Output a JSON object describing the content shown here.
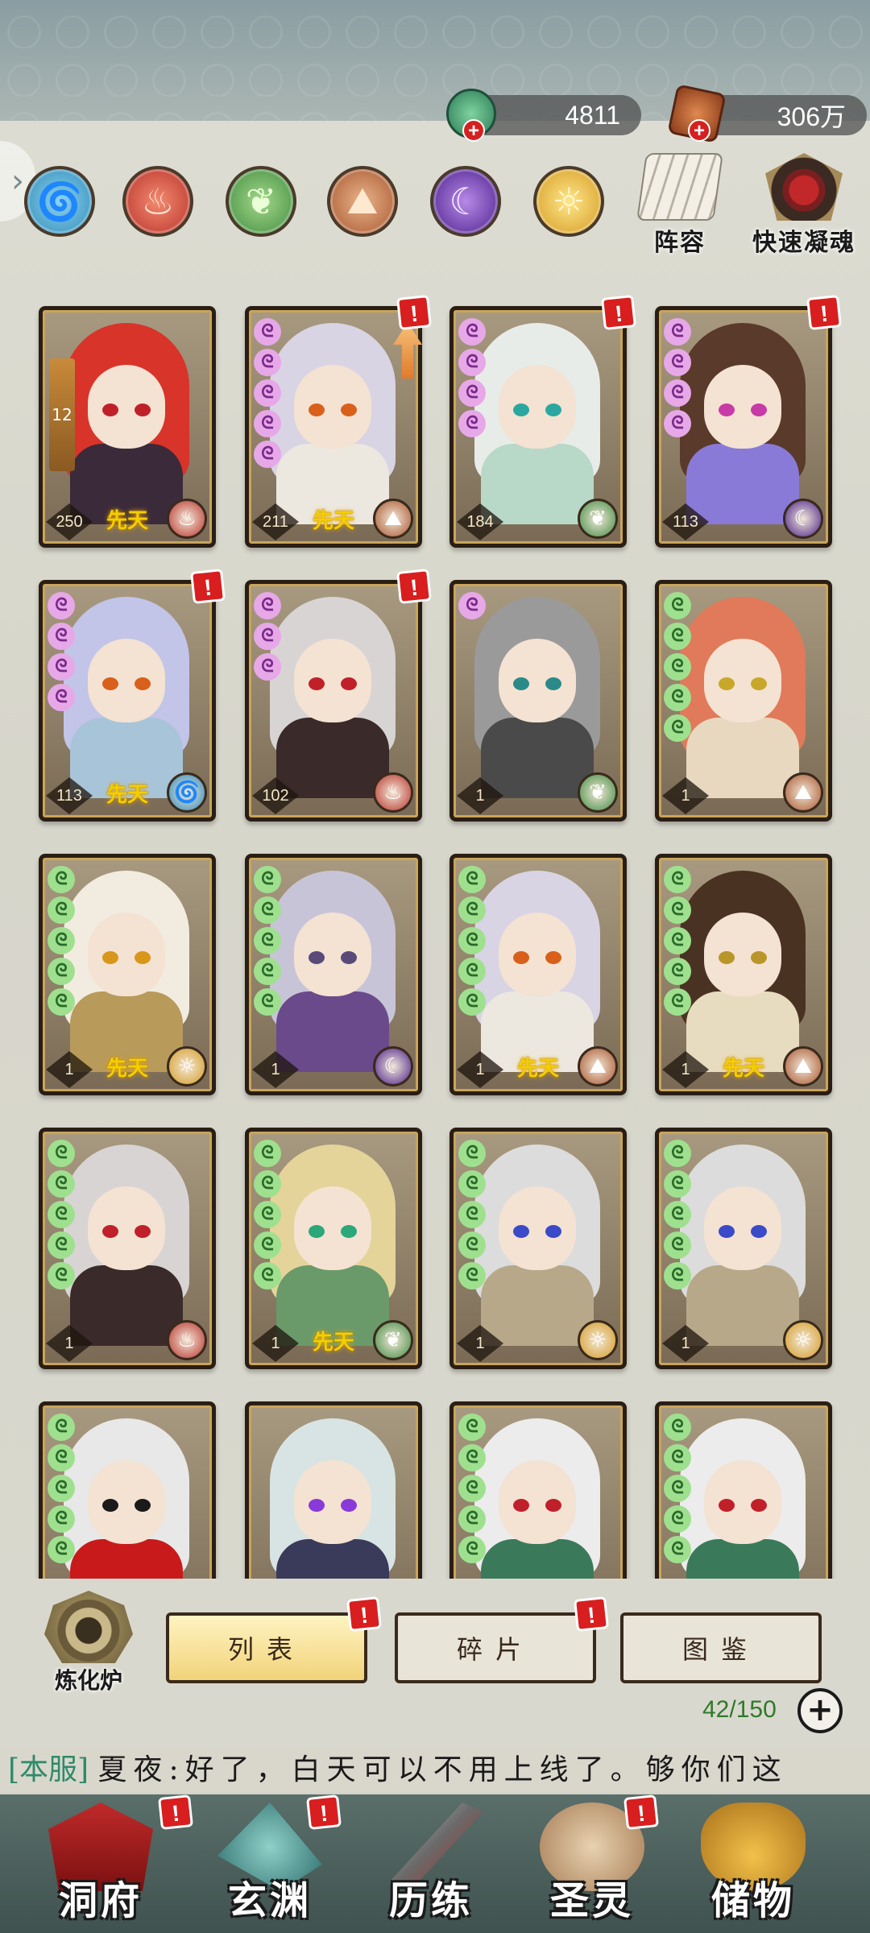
{
  "currencies": [
    {
      "icon": "jade-coin-icon",
      "value": "4811"
    },
    {
      "icon": "ore-icon",
      "value": "306万"
    }
  ],
  "element_filters": [
    {
      "name": "water",
      "glyph": "🌀",
      "color": "#2f8ab8"
    },
    {
      "name": "fire",
      "glyph": "♨",
      "color": "#b8322a"
    },
    {
      "name": "wood",
      "glyph": "❦",
      "color": "#3f8a40"
    },
    {
      "name": "earth",
      "glyph": "⛰",
      "color": "#a8552e"
    },
    {
      "name": "dark",
      "glyph": "☾",
      "color": "#4a1f8a"
    },
    {
      "name": "light",
      "glyph": "☼",
      "color": "#d49a22"
    }
  ],
  "top_buttons": {
    "lineup_label": "阵容",
    "quick_soul_label": "快速凝魂"
  },
  "cards": [
    {
      "level": "250",
      "innate": "先天",
      "element": "fire",
      "pips": 0,
      "pip_color": "pink",
      "alert": false,
      "hair": "#d8342a",
      "eyes": "#c0202a",
      "outfit": "#3a2a3a",
      "star_bar": "12"
    },
    {
      "level": "211",
      "innate": "先天",
      "element": "earth",
      "pips": 5,
      "pip_color": "pink",
      "alert": true,
      "hair": "#d8d4e4",
      "eyes": "#d8601a",
      "outfit": "#ece8e0",
      "up_arrow": true
    },
    {
      "level": "184",
      "innate": "",
      "element": "wood",
      "pips": 4,
      "pip_color": "pink",
      "alert": true,
      "hair": "#e8ece8",
      "eyes": "#2aa8a0",
      "outfit": "#b8d8c8"
    },
    {
      "level": "113",
      "innate": "",
      "element": "dark",
      "pips": 4,
      "pip_color": "pink",
      "alert": true,
      "hair": "#5a3a2a",
      "eyes": "#c83aa8",
      "outfit": "#8a7ad8"
    },
    {
      "level": "113",
      "innate": "先天",
      "element": "water",
      "pips": 4,
      "pip_color": "pink",
      "alert": true,
      "hair": "#c2c4e8",
      "eyes": "#d8601a",
      "outfit": "#a8c4d8"
    },
    {
      "level": "102",
      "innate": "",
      "element": "fire",
      "pips": 3,
      "pip_color": "pink",
      "alert": true,
      "hair": "#d8d4d4",
      "eyes": "#c0202a",
      "outfit": "#3a2a2a"
    },
    {
      "level": "1",
      "innate": "",
      "element": "wood",
      "pips": 1,
      "pip_color": "pink",
      "alert": false,
      "hair": "#9a9a9a",
      "eyes": "#2a8a8a",
      "outfit": "#4a4a4a"
    },
    {
      "level": "1",
      "innate": "",
      "element": "earth",
      "pips": 5,
      "pip_color": "green",
      "alert": false,
      "hair": "#e07a5a",
      "eyes": "#c8a82a",
      "outfit": "#e8d8c0"
    },
    {
      "level": "1",
      "innate": "先天",
      "element": "light",
      "pips": 5,
      "pip_color": "green",
      "alert": false,
      "hair": "#f2ece0",
      "eyes": "#d8961a",
      "outfit": "#b89a5a"
    },
    {
      "level": "1",
      "innate": "",
      "element": "dark",
      "pips": 5,
      "pip_color": "green",
      "alert": false,
      "hair": "#c8c4d8",
      "eyes": "#5a4a7a",
      "outfit": "#6a4a8a"
    },
    {
      "level": "1",
      "innate": "先天",
      "element": "earth",
      "pips": 5,
      "pip_color": "green",
      "alert": false,
      "hair": "#d8d4e4",
      "eyes": "#d8601a",
      "outfit": "#ece8e0"
    },
    {
      "level": "1",
      "innate": "先天",
      "element": "earth",
      "pips": 5,
      "pip_color": "green",
      "alert": false,
      "hair": "#4a3222",
      "eyes": "#b8962a",
      "outfit": "#e8dcc0"
    },
    {
      "level": "1",
      "innate": "",
      "element": "fire",
      "pips": 5,
      "pip_color": "green",
      "alert": false,
      "hair": "#d8d4d4",
      "eyes": "#c0202a",
      "outfit": "#3a2a2a"
    },
    {
      "level": "1",
      "innate": "先天",
      "element": "wood",
      "pips": 5,
      "pip_color": "green",
      "alert": false,
      "hair": "#e4d49a",
      "eyes": "#2aa87a",
      "outfit": "#6a9a6a"
    },
    {
      "level": "1",
      "innate": "",
      "element": "light",
      "pips": 5,
      "pip_color": "green",
      "alert": false,
      "hair": "#dcdcdc",
      "eyes": "#3a4ac8",
      "outfit": "#b8a88a"
    },
    {
      "level": "1",
      "innate": "",
      "element": "light",
      "pips": 5,
      "pip_color": "green",
      "alert": false,
      "hair": "#dcdcdc",
      "eyes": "#3a4ac8",
      "outfit": "#b8a88a"
    },
    {
      "level": "",
      "innate": "",
      "element": "",
      "pips": 5,
      "pip_color": "green",
      "alert": false,
      "hair": "#e8e8e8",
      "eyes": "#1a1a1a",
      "outfit": "#c81a1a"
    },
    {
      "level": "",
      "innate": "",
      "element": "",
      "pips": 0,
      "pip_color": "green",
      "alert": false,
      "hair": "#d8e4e4",
      "eyes": "#8a3ad8",
      "outfit": "#3a3a5a"
    },
    {
      "level": "",
      "innate": "",
      "element": "",
      "pips": 5,
      "pip_color": "green",
      "alert": false,
      "hair": "#ececec",
      "eyes": "#c0202a",
      "outfit": "#3a7a5a"
    },
    {
      "level": "",
      "innate": "",
      "element": "",
      "pips": 5,
      "pip_color": "green",
      "alert": false,
      "hair": "#ececec",
      "eyes": "#c0202a",
      "outfit": "#3a7a5a"
    }
  ],
  "element_glyphs": {
    "fire": "♨",
    "earth": "⛰",
    "wood": "❦",
    "dark": "☾",
    "water": "🌀",
    "light": "☼"
  },
  "element_colors": {
    "fire": "#b8322a",
    "earth": "#a8552e",
    "wood": "#3f8a40",
    "dark": "#4a1f8a",
    "water": "#2f8ab8",
    "light": "#d49a22"
  },
  "furnace_label": "炼化炉",
  "tabs": [
    {
      "label": "列表",
      "active": true,
      "alert": true
    },
    {
      "label": "碎片",
      "active": false,
      "alert": true
    },
    {
      "label": "图鉴",
      "active": false,
      "alert": false
    }
  ],
  "capacity": "42/150",
  "chat": {
    "channel": "[本服]",
    "message": "夏夜:好了，白天可以不用上线了。够你们这"
  },
  "nav": [
    {
      "label": "洞府",
      "icon": "cave-house-icon",
      "alert": true
    },
    {
      "label": "玄渊",
      "icon": "abyss-sword-icon",
      "alert": true
    },
    {
      "label": "历练",
      "icon": "blade-icon",
      "alert": false
    },
    {
      "label": "圣灵",
      "icon": "tiger-spirit-icon",
      "alert": true
    },
    {
      "label": "储物",
      "icon": "treasure-bag-icon",
      "alert": false
    }
  ],
  "alert_mark": "!"
}
